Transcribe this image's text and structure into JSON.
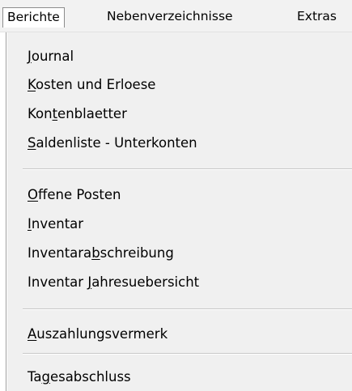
{
  "menubar": {
    "items": [
      {
        "label": "Berichte",
        "open": true
      },
      {
        "label": "Nebenverzeichnisse",
        "open": false
      },
      {
        "label": "Extras",
        "open": false
      }
    ]
  },
  "menu": {
    "items": [
      {
        "label": "Journal",
        "mnemonic_index": 0
      },
      {
        "label": "Kosten und Erloese",
        "mnemonic_index": 0
      },
      {
        "label": "Kontenblaetter",
        "mnemonic_index": 3
      },
      {
        "label": "Saldenliste - Unterkonten",
        "mnemonic_index": 0
      },
      {
        "label": "Offene Posten",
        "mnemonic_index": 0
      },
      {
        "label": "Inventar",
        "mnemonic_index": 0
      },
      {
        "label": "Inventarabschreibung",
        "mnemonic_index": 9
      },
      {
        "label": "Inventar Jahresuebersicht",
        "mnemonic_index": 9
      },
      {
        "label": "Auszahlungsvermerk",
        "mnemonic_index": 0
      },
      {
        "label": "Tagesabschluss",
        "mnemonic_index": 2
      }
    ]
  }
}
